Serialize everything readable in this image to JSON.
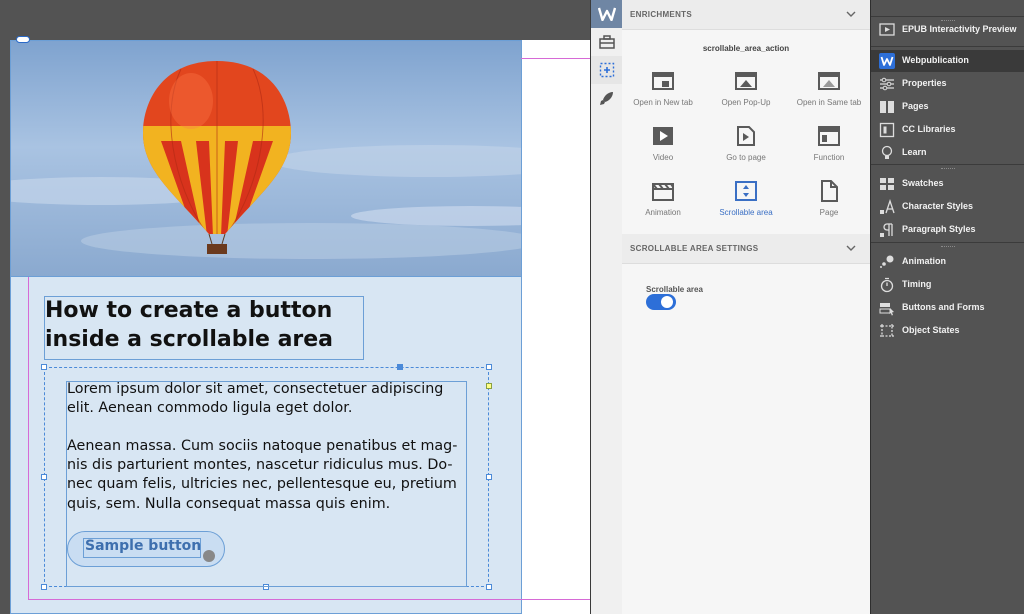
{
  "document": {
    "heading": "How to create a button inside a scrollable area",
    "paragraph_1": "Lorem ipsum dolor sit amet, consectetuer adipiscing elit. Aenean commodo ligula eget dolor.",
    "paragraph_2": "Aenean massa. Cum sociis natoque penatibus et mag-nis dis parturient montes, nascetur ridiculus mus. Do-nec quam felis, ultricies nec, pellentesque eu, pretium quis, sem. Nulla consequat massa quis enim.",
    "sample_button_label": "Sample button"
  },
  "enrichments": {
    "title": "ENRICHMENTS",
    "action_name": "scrollable_area_action",
    "actions": [
      {
        "label": "Open in New tab",
        "icon": "open-new-tab-icon"
      },
      {
        "label": "Open Pop-Up",
        "icon": "popup-icon"
      },
      {
        "label": "Open in Same tab",
        "icon": "same-tab-icon"
      },
      {
        "label": "Video",
        "icon": "video-icon"
      },
      {
        "label": "Go to page",
        "icon": "go-to-page-icon"
      },
      {
        "label": "Function",
        "icon": "function-icon"
      },
      {
        "label": "Animation",
        "icon": "animation-icon"
      },
      {
        "label": "Scrollable area",
        "icon": "scrollable-area-icon",
        "active": true
      },
      {
        "label": "Page",
        "icon": "page-icon"
      }
    ],
    "settings_title": "SCROLLABLE AREA SETTINGS",
    "scrollable_area_label": "Scrollable area",
    "scrollable_area_enabled": true
  },
  "dock": {
    "groups": [
      {
        "items": [
          {
            "label": "EPUB Interactivity Preview",
            "icon": "epub-preview-icon"
          }
        ]
      },
      {
        "items": [
          {
            "label": "Webpublication",
            "icon": "webpublication-icon",
            "active": true
          },
          {
            "label": "Properties",
            "icon": "properties-icon"
          },
          {
            "label": "Pages",
            "icon": "pages-icon"
          },
          {
            "label": "CC Libraries",
            "icon": "cc-libraries-icon"
          },
          {
            "label": "Learn",
            "icon": "learn-icon"
          }
        ]
      },
      {
        "items": [
          {
            "label": "Swatches",
            "icon": "swatches-icon"
          },
          {
            "label": "Character Styles",
            "icon": "character-styles-icon"
          },
          {
            "label": "Paragraph Styles",
            "icon": "paragraph-styles-icon"
          }
        ]
      },
      {
        "items": [
          {
            "label": "Animation",
            "icon": "animation-icon"
          },
          {
            "label": "Timing",
            "icon": "timing-icon"
          },
          {
            "label": "Buttons and Forms",
            "icon": "buttons-forms-icon"
          },
          {
            "label": "Object States",
            "icon": "object-states-icon"
          }
        ]
      }
    ]
  },
  "colors": {
    "accent": "#2d6fd8",
    "panel_bg": "#f6f6f6",
    "dock_bg": "#535353",
    "frame_fill": "#d8e6f3"
  }
}
